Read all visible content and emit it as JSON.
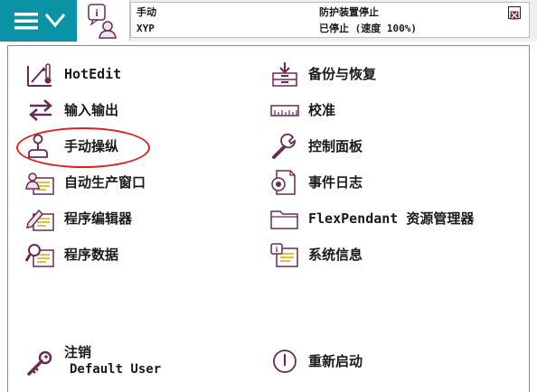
{
  "status": {
    "mode": "手动",
    "unit": "XYP",
    "safety": "防护装置停止",
    "run_state": "已停止 (速度 100%)"
  },
  "menu_left": [
    {
      "label": "HotEdit",
      "icon": "hotedit-icon"
    },
    {
      "label": "输入输出",
      "icon": "io-arrows-icon"
    },
    {
      "label": "手动操纵",
      "icon": "joystick-icon"
    },
    {
      "label": "自动生产窗口",
      "icon": "auto-production-icon"
    },
    {
      "label": "程序编辑器",
      "icon": "program-editor-icon"
    },
    {
      "label": "程序数据",
      "icon": "program-data-icon"
    }
  ],
  "menu_right": [
    {
      "label": "备份与恢复",
      "icon": "backup-restore-icon"
    },
    {
      "label": "校准",
      "icon": "calibration-ruler-icon"
    },
    {
      "label": "控制面板",
      "icon": "wrench-icon"
    },
    {
      "label": "事件日志",
      "icon": "event-log-icon"
    },
    {
      "label": "FlexPendant 资源管理器",
      "icon": "folder-icon"
    },
    {
      "label": "系统信息",
      "icon": "system-info-icon"
    }
  ],
  "logout": {
    "label": "注销",
    "user": "Default User",
    "icon": "key-icon"
  },
  "restart": {
    "label": "重新启动",
    "icon": "power-icon"
  },
  "colors": {
    "accent": "#0a93a5",
    "icon": "#6b2a55",
    "highlight": "#e02121"
  }
}
